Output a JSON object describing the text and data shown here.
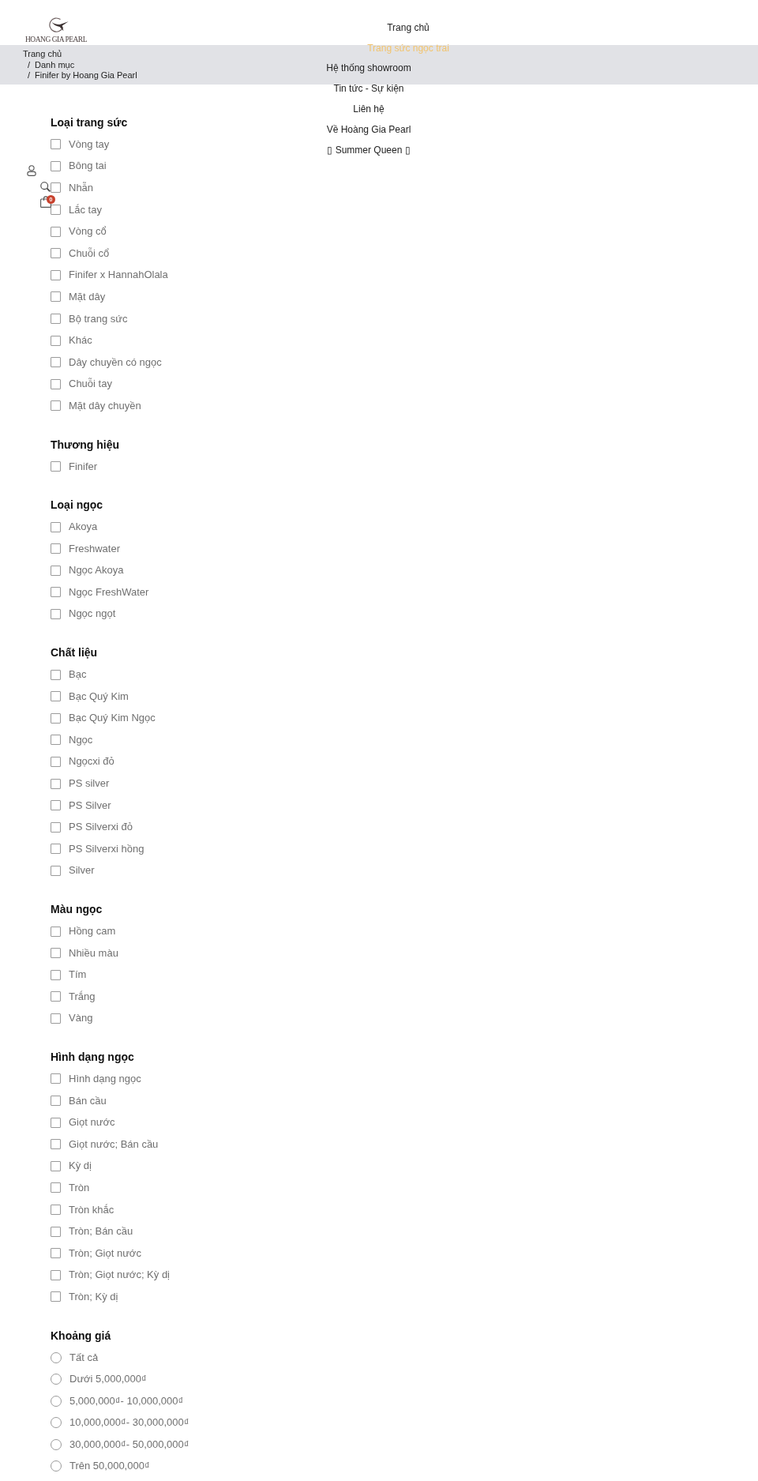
{
  "header": {
    "logo": {
      "text": "HOANG GIA PEARL"
    },
    "nav": [
      {
        "label": "Trang chủ",
        "selected": false
      },
      {
        "label": "Trang sức ngọc trai",
        "selected": true
      },
      {
        "label": "Hệ thống showroom",
        "selected": false
      },
      {
        "label": "Tin tức - Sự kiện",
        "selected": false
      },
      {
        "label": "Liên hệ",
        "selected": false
      },
      {
        "label": "Về Hoàng Gia Pearl",
        "selected": false
      },
      {
        "label": "▯ Summer Queen ▯",
        "selected": false
      }
    ],
    "cart_count": "0"
  },
  "breadcrumb": [
    {
      "label": "Trang chủ"
    },
    {
      "separator": "/",
      "label": "Danh mục"
    },
    {
      "separator": "/",
      "label": "Finifer by Hoang Gia Pearl"
    }
  ],
  "filters": [
    {
      "title": "Loại trang sức",
      "kind": "checkbox",
      "items": [
        {
          "label": "Vòng tay",
          "checked": false
        },
        {
          "label": "Bông tai",
          "checked": false
        },
        {
          "label": "Nhẫn",
          "checked": false
        },
        {
          "label": "Lắc tay",
          "checked": false
        },
        {
          "label": "Vòng cổ",
          "checked": false
        },
        {
          "label": "Chuỗi cổ",
          "checked": false
        },
        {
          "label": "Finifer x HannahOlala",
          "checked": false
        },
        {
          "label": "Mặt dây",
          "checked": false
        },
        {
          "label": "Bộ trang sức",
          "checked": false
        },
        {
          "label": "Khác",
          "checked": false
        },
        {
          "label": "Dây chuyền có ngọc",
          "checked": false
        },
        {
          "label": "Chuỗi tay",
          "checked": false
        },
        {
          "label": "Mặt dây chuyền",
          "checked": false
        }
      ]
    },
    {
      "title": "Thương hiệu",
      "kind": "checkbox",
      "items": [
        {
          "label": "Finifer",
          "checked": false
        }
      ]
    },
    {
      "title": "Loại ngọc",
      "kind": "checkbox",
      "items": [
        {
          "label": "Akoya",
          "checked": false
        },
        {
          "label": "Freshwater",
          "checked": false
        },
        {
          "label": "Ngọc Akoya",
          "checked": false
        },
        {
          "label": "Ngọc FreshWater",
          "checked": false
        },
        {
          "label": "Ngọc ngọt",
          "checked": false
        }
      ]
    },
    {
      "title": "Chất liệu",
      "kind": "checkbox",
      "items": [
        {
          "label": "Bạc",
          "checked": false
        },
        {
          "label": "Bạc Quý Kim",
          "checked": false
        },
        {
          "label": "Bạc Quý Kim Ngọc",
          "checked": false
        },
        {
          "label": "Ngọc",
          "checked": false
        },
        {
          "label": "Ngọcxi đỏ",
          "checked": false
        },
        {
          "label": "PS silver",
          "checked": false
        },
        {
          "label": "PS Silver",
          "checked": false
        },
        {
          "label": "PS Silverxi đỏ",
          "checked": false
        },
        {
          "label": "PS Silverxi hồng",
          "checked": false
        },
        {
          "label": "Silver",
          "checked": false
        }
      ]
    },
    {
      "title": "Màu ngọc",
      "kind": "checkbox",
      "items": [
        {
          "label": "Hồng cam",
          "checked": false
        },
        {
          "label": "Nhiều màu",
          "checked": false
        },
        {
          "label": "Tím",
          "checked": false
        },
        {
          "label": "Trắng",
          "checked": false
        },
        {
          "label": "Vàng",
          "checked": false
        }
      ]
    },
    {
      "title": "Hình dạng ngọc",
      "kind": "checkbox",
      "items": [
        {
          "label": "Hình dạng ngọc",
          "checked": false
        },
        {
          "label": "Bán cầu",
          "checked": false
        },
        {
          "label": "Giọt nước",
          "checked": false
        },
        {
          "label": "Giọt nước; Bán cầu",
          "checked": false
        },
        {
          "label": "Kỳ dị",
          "checked": false
        },
        {
          "label": "Tròn",
          "checked": false
        },
        {
          "label": "Tròn khắc",
          "checked": false
        },
        {
          "label": "Tròn; Bán cầu",
          "checked": false
        },
        {
          "label": "Tròn; Giọt nước",
          "checked": false
        },
        {
          "label": "Tròn; Giọt nước; Kỳ dị",
          "checked": false
        },
        {
          "label": "Tròn; Kỳ dị",
          "checked": false
        }
      ]
    },
    {
      "title": "Khoảng giá",
      "kind": "radio",
      "items": [
        {
          "label": "Tất cả",
          "selected": false
        },
        {
          "label": "Dưới 5,000,000₫",
          "selected": false
        },
        {
          "label": "5,000,000₫- 10,000,000₫",
          "selected": false
        },
        {
          "label": "10,000,000₫- 30,000,000₫",
          "selected": false
        },
        {
          "label": "30,000,000₫- 50,000,000₫",
          "selected": false
        },
        {
          "label": "Trên 50,000,000₫",
          "selected": false
        }
      ]
    }
  ]
}
